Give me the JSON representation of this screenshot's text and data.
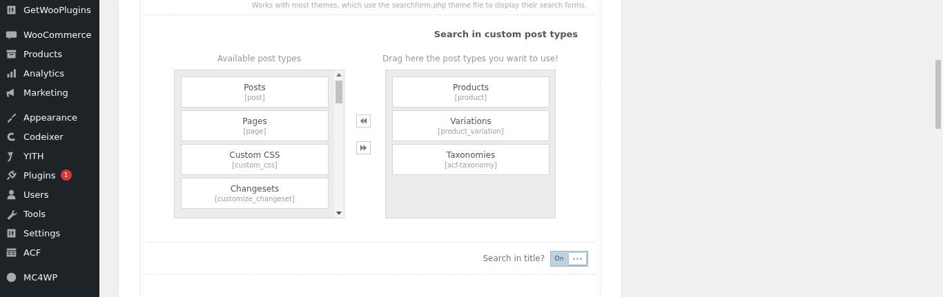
{
  "sidebar": {
    "groups": [
      {
        "items": [
          {
            "label": "GetWooPlugins"
          }
        ]
      },
      {
        "items": [
          {
            "label": "WooCommerce"
          },
          {
            "label": "Products"
          },
          {
            "label": "Analytics"
          },
          {
            "label": "Marketing"
          }
        ]
      },
      {
        "items": [
          {
            "label": "Appearance"
          },
          {
            "label": "Codeixer"
          },
          {
            "label": "YITH"
          },
          {
            "label": "Plugins",
            "badge": "1"
          },
          {
            "label": "Users"
          },
          {
            "label": "Tools"
          },
          {
            "label": "Settings"
          },
          {
            "label": "ACF"
          }
        ]
      },
      {
        "items": [
          {
            "label": "MC4WP"
          }
        ]
      }
    ]
  },
  "intro_note": "Works with most themes, which use the searchform.php theme file to display their search forms.",
  "post_types": {
    "title": "Search in custom post types",
    "available": {
      "heading": "Available post types",
      "items": [
        {
          "name": "Posts",
          "slug": "[post]"
        },
        {
          "name": "Pages",
          "slug": "[page]"
        },
        {
          "name": "Custom CSS",
          "slug": "[custom_css]"
        },
        {
          "name": "Changesets",
          "slug": "[customize_changeset]"
        }
      ]
    },
    "selected": {
      "heading": "Drag here the post types you want to use!",
      "items": [
        {
          "name": "Products",
          "slug": "[product]"
        },
        {
          "name": "Variations",
          "slug": "[product_variation]"
        },
        {
          "name": "Taxonomies",
          "slug": "[acf-taxonomy]"
        }
      ]
    }
  },
  "toggles": [
    {
      "label": "Search in title?",
      "state_text": "On",
      "on": true
    }
  ]
}
